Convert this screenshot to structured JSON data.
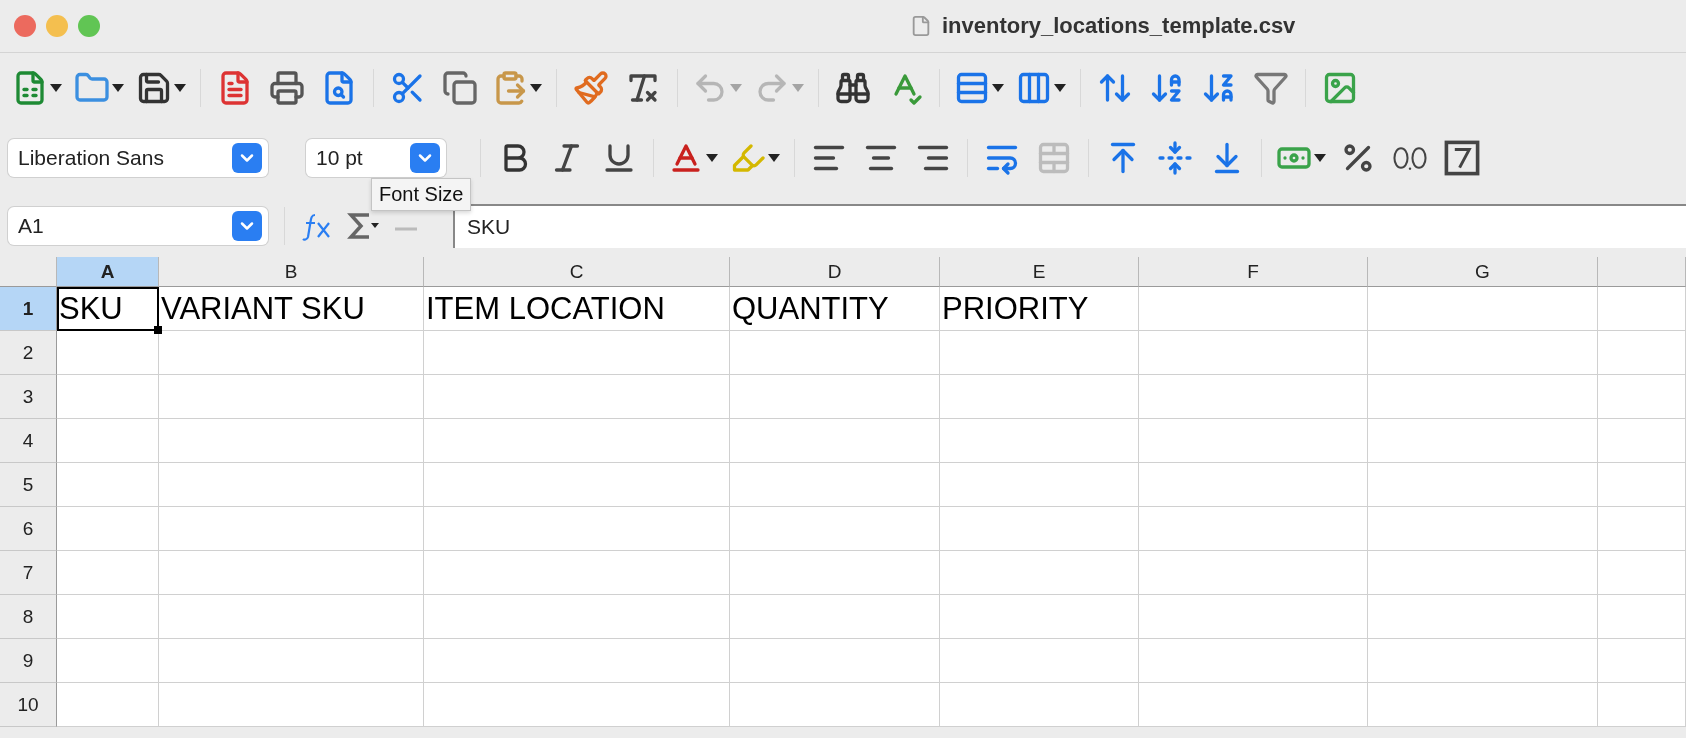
{
  "window": {
    "title": "inventory_locations_template.csv"
  },
  "toolbar_standard": [
    {
      "kind": "new-spreadsheet",
      "menu": true,
      "disabled": false
    },
    {
      "kind": "open",
      "menu": true,
      "disabled": false
    },
    {
      "kind": "save",
      "menu": true,
      "disabled": false
    },
    {
      "kind": "sep"
    },
    {
      "kind": "export-pdf",
      "menu": false,
      "disabled": false
    },
    {
      "kind": "print",
      "menu": false,
      "disabled": false
    },
    {
      "kind": "print-preview",
      "menu": false,
      "disabled": false
    },
    {
      "kind": "sep"
    },
    {
      "kind": "cut",
      "menu": false,
      "disabled": false
    },
    {
      "kind": "copy",
      "menu": false,
      "disabled": false
    },
    {
      "kind": "paste",
      "menu": true,
      "disabled": false
    },
    {
      "kind": "sep"
    },
    {
      "kind": "clone-formatting",
      "menu": false,
      "disabled": false
    },
    {
      "kind": "clear-formatting",
      "menu": false,
      "disabled": false
    },
    {
      "kind": "sep"
    },
    {
      "kind": "undo",
      "menu": true,
      "disabled": true
    },
    {
      "kind": "redo",
      "menu": true,
      "disabled": true
    },
    {
      "kind": "sep"
    },
    {
      "kind": "find",
      "menu": false,
      "disabled": false
    },
    {
      "kind": "spelling",
      "menu": false,
      "disabled": false
    },
    {
      "kind": "sep"
    },
    {
      "kind": "row",
      "menu": true,
      "disabled": false
    },
    {
      "kind": "column",
      "menu": true,
      "disabled": false
    },
    {
      "kind": "sep"
    },
    {
      "kind": "sort",
      "menu": false,
      "disabled": false
    },
    {
      "kind": "sort-ascending",
      "menu": false,
      "disabled": false
    },
    {
      "kind": "sort-descending",
      "menu": false,
      "disabled": false
    },
    {
      "kind": "autofilter",
      "menu": false,
      "disabled": false
    },
    {
      "kind": "sep"
    },
    {
      "kind": "image",
      "menu": false,
      "disabled": false
    }
  ],
  "font_name": {
    "value": "Liberation Sans"
  },
  "font_size": {
    "value": "10 pt"
  },
  "toolbar_formatting": [
    {
      "kind": "sep"
    },
    {
      "kind": "bold",
      "menu": false,
      "disabled": false
    },
    {
      "kind": "italic",
      "menu": false,
      "disabled": false
    },
    {
      "kind": "underline",
      "menu": false,
      "disabled": false
    },
    {
      "kind": "sep"
    },
    {
      "kind": "font-color",
      "menu": true,
      "disabled": false
    },
    {
      "kind": "highlight",
      "menu": true,
      "disabled": false
    },
    {
      "kind": "sep"
    },
    {
      "kind": "align-left",
      "menu": false,
      "disabled": false
    },
    {
      "kind": "align-center",
      "menu": false,
      "disabled": false
    },
    {
      "kind": "align-right",
      "menu": false,
      "disabled": false
    },
    {
      "kind": "sep"
    },
    {
      "kind": "wrap",
      "menu": false,
      "disabled": false
    },
    {
      "kind": "merge",
      "menu": false,
      "disabled": true
    },
    {
      "kind": "sep"
    },
    {
      "kind": "align-top",
      "menu": false,
      "disabled": false
    },
    {
      "kind": "align-middle",
      "menu": false,
      "disabled": false
    },
    {
      "kind": "align-bottom",
      "menu": false,
      "disabled": false
    },
    {
      "kind": "sep"
    },
    {
      "kind": "currency",
      "menu": true,
      "disabled": false
    },
    {
      "kind": "percent",
      "menu": false,
      "disabled": false
    },
    {
      "kind": "decimal",
      "menu": false,
      "disabled": false
    },
    {
      "kind": "number",
      "menu": false,
      "disabled": false
    }
  ],
  "tooltip": {
    "text": "Font Size"
  },
  "name_box": {
    "value": "A1"
  },
  "formula": {
    "value": "SKU"
  },
  "sheet": {
    "columns": [
      {
        "label": "A",
        "selected": true
      },
      {
        "label": "B",
        "selected": false
      },
      {
        "label": "C",
        "selected": false
      },
      {
        "label": "D",
        "selected": false
      },
      {
        "label": "E",
        "selected": false
      },
      {
        "label": "F",
        "selected": false
      },
      {
        "label": "G",
        "selected": false
      }
    ],
    "rows": [
      {
        "label": "1",
        "selected": true,
        "cells": [
          {
            "text": "SKU",
            "selected": true
          },
          {
            "text": "VARIANT SKU",
            "selected": false
          },
          {
            "text": "ITEM LOCATION",
            "selected": false
          },
          {
            "text": "QUANTITY",
            "selected": false
          },
          {
            "text": "PRIORITY",
            "selected": false
          }
        ]
      },
      {
        "label": "2",
        "selected": false
      },
      {
        "label": "3",
        "selected": false
      },
      {
        "label": "4",
        "selected": false
      },
      {
        "label": "5",
        "selected": false
      },
      {
        "label": "6",
        "selected": false
      },
      {
        "label": "7",
        "selected": false
      },
      {
        "label": "8",
        "selected": false
      },
      {
        "label": "9",
        "selected": false
      },
      {
        "label": "10",
        "selected": false
      }
    ]
  }
}
